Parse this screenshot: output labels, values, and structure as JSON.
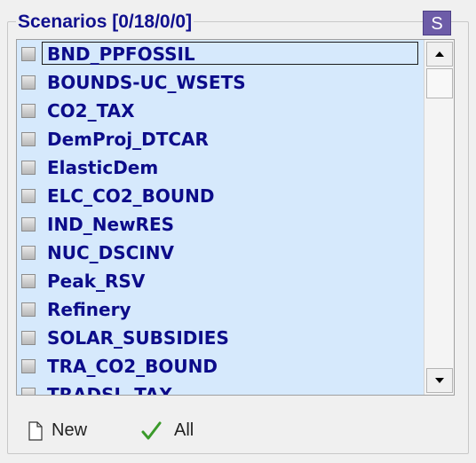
{
  "group": {
    "title": "Scenarios [0/18/0/0]",
    "badge": "S"
  },
  "scenarios": [
    {
      "label": "BND_PPFOSSIL",
      "checked": false,
      "focused": true
    },
    {
      "label": "BOUNDS-UC_WSETS",
      "checked": false
    },
    {
      "label": "CO2_TAX",
      "checked": false
    },
    {
      "label": "DemProj_DTCAR",
      "checked": false
    },
    {
      "label": "ElasticDem",
      "checked": false
    },
    {
      "label": "ELC_CO2_BOUND",
      "checked": false
    },
    {
      "label": "IND_NewRES",
      "checked": false
    },
    {
      "label": "NUC_DSCINV",
      "checked": false
    },
    {
      "label": "Peak_RSV",
      "checked": false
    },
    {
      "label": "Refinery",
      "checked": false
    },
    {
      "label": "SOLAR_SUBSIDIES",
      "checked": false
    },
    {
      "label": "TRA_CO2_BOUND",
      "checked": false
    },
    {
      "label": "TRADSL_TAX",
      "checked": false
    }
  ],
  "scrollbar": {
    "up_icon": "scroll-up-arrow",
    "down_icon": "scroll-down-arrow"
  },
  "toolbar": {
    "new_label": "New",
    "new_icon": "new-document-icon",
    "all_label": "All",
    "all_icon": "checkmark-icon"
  },
  "colors": {
    "title": "#10108e",
    "list_background": "#d6e9fc",
    "item_text": "#0c0c8a",
    "badge": "#6d5ca8",
    "checkmark": "#3a9a2a"
  }
}
